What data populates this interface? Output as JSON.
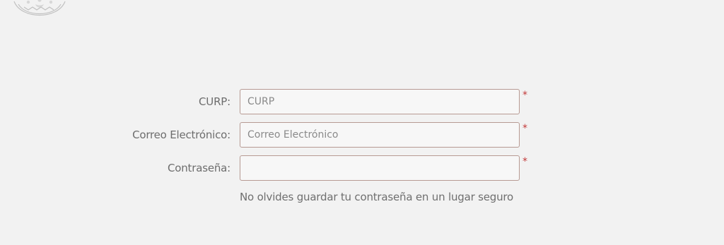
{
  "form": {
    "fields": [
      {
        "label": "CURP:",
        "placeholder": "CURP",
        "value": ""
      },
      {
        "label": "Correo Electrónico:",
        "placeholder": "Correo Electrónico",
        "value": ""
      },
      {
        "label": "Contraseña:",
        "placeholder": "",
        "value": ""
      }
    ],
    "required_marker": "*",
    "hint": "No olvides guardar tu contraseña en un lugar seguro"
  },
  "colors": {
    "background": "#f2f2f2",
    "input_border": "#b79a93",
    "required": "#c33a3a",
    "text": "#6d6d6d"
  },
  "icons": {
    "seal": "national-seal-icon"
  }
}
